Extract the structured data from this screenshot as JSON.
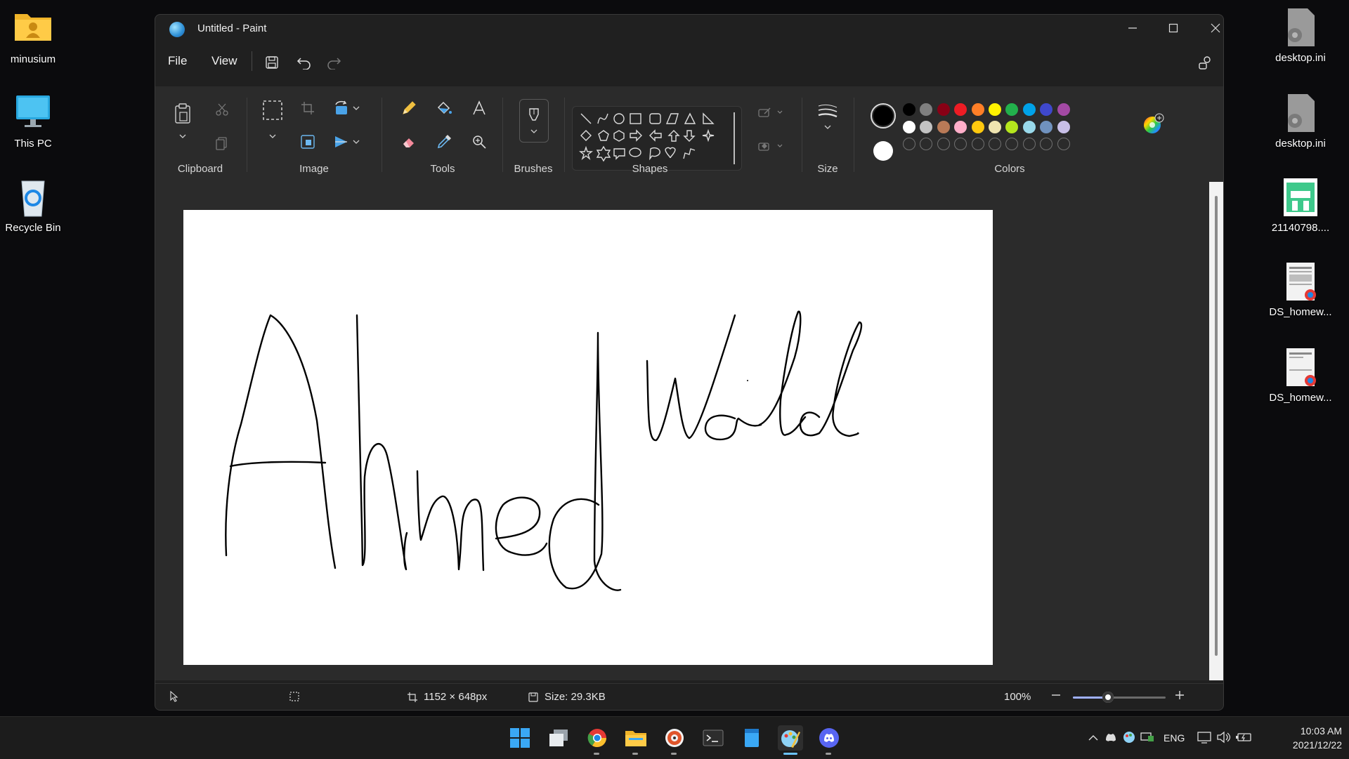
{
  "desktop": {
    "left_icons": [
      {
        "label": "minusium"
      },
      {
        "label": "This PC"
      },
      {
        "label": "Recycle Bin"
      }
    ],
    "right_icons": [
      {
        "label": "desktop.ini"
      },
      {
        "label": "desktop.ini"
      },
      {
        "label": "21140798...."
      },
      {
        "label": "DS_homew..."
      },
      {
        "label": "DS_homew..."
      }
    ]
  },
  "window": {
    "title": "Untitled - Paint",
    "menu": {
      "file": "File",
      "view": "View"
    }
  },
  "ribbon": {
    "groups": {
      "clipboard": "Clipboard",
      "image": "Image",
      "tools": "Tools",
      "brushes": "Brushes",
      "shapes": "Shapes",
      "size": "Size",
      "colors": "Colors"
    },
    "palette": {
      "row1": [
        "#000000",
        "#7f7f7f",
        "#880015",
        "#ed1c24",
        "#ff7f27",
        "#fff200",
        "#22b14c",
        "#00a2e8",
        "#3f48cc",
        "#a349a4"
      ],
      "row2": [
        "#ffffff",
        "#c3c3c3",
        "#b97a57",
        "#ffaec9",
        "#ffc90e",
        "#efe4b0",
        "#b5e61d",
        "#99d9ea",
        "#7092be",
        "#c8bfe7"
      ]
    },
    "color1": "#000000",
    "color2": "#ffffff"
  },
  "canvas": {
    "drawing": "Ahmed Walid"
  },
  "status": {
    "dimensions": "1152 × 648px",
    "size": "Size: 29.3KB",
    "zoom": "100%",
    "zoom_level": 0.38
  },
  "taskbar": {
    "language": "ENG",
    "time": "10:03 AM",
    "date": "2021/12/22"
  }
}
